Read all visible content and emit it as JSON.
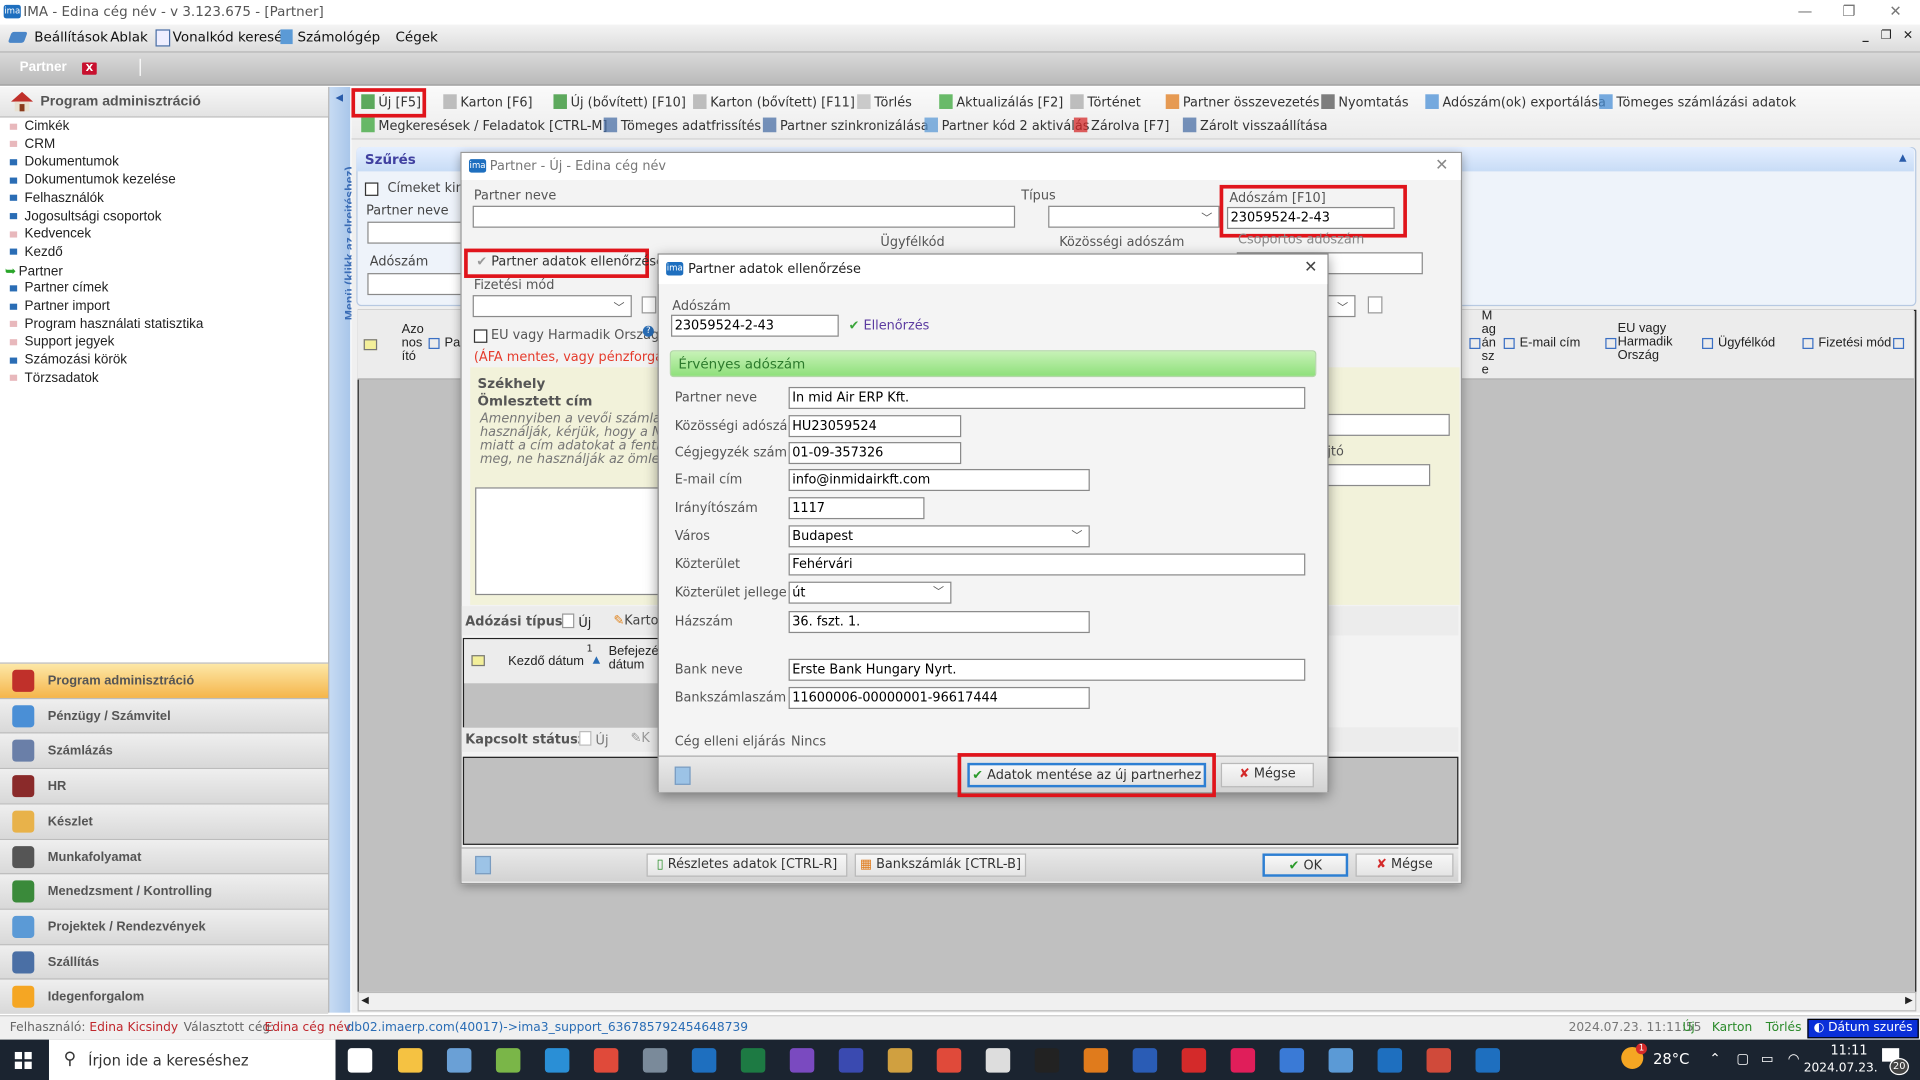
{
  "window": {
    "title": "IMA - Edina cég név - v 3.123.675 - [Partner]",
    "controls": [
      "minimize",
      "restore",
      "close"
    ]
  },
  "menubar": {
    "items": [
      {
        "label": "Beállítások",
        "icon": "settings-icon"
      },
      {
        "label": "Ablak",
        "icon": ""
      },
      {
        "label": "Vonalkód keresés",
        "icon": "barcode-search-icon"
      },
      {
        "label": "Számológép",
        "icon": "calculator-icon"
      },
      {
        "label": "Cégek",
        "icon": ""
      }
    ]
  },
  "tabs": {
    "active": "Partner",
    "close_label": "X"
  },
  "sidebar": {
    "header": "Program adminisztráció",
    "items": [
      {
        "label": "Cimkék",
        "bullet": "pink"
      },
      {
        "label": "CRM",
        "bullet": "pink"
      },
      {
        "label": "Dokumentumok",
        "bullet": "blue"
      },
      {
        "label": "Dokumentumok kezelése",
        "bullet": "blue"
      },
      {
        "label": "Felhasználók",
        "bullet": "blue"
      },
      {
        "label": "Jogosultsági csoportok",
        "bullet": "blue"
      },
      {
        "label": "Kedvencek",
        "bullet": "pink"
      },
      {
        "label": "Kezdő",
        "bullet": "blue"
      },
      {
        "label": "Partner",
        "bullet": "arrow",
        "active": true
      },
      {
        "label": "Partner címek",
        "bullet": "blue"
      },
      {
        "label": "Partner import",
        "bullet": "blue"
      },
      {
        "label": "Program használati statisztika",
        "bullet": "pink"
      },
      {
        "label": "Support jegyek",
        "bullet": "pink"
      },
      {
        "label": "Számozási körök",
        "bullet": "blue"
      },
      {
        "label": "Törzsadatok",
        "bullet": "pink"
      }
    ],
    "modules": [
      {
        "label": "Program adminisztráció",
        "icon": "house-icon",
        "active": true
      },
      {
        "label": "Pénzügy / Számvitel",
        "icon": "calculator-icon"
      },
      {
        "label": "Számlázás",
        "icon": "invoice-icon"
      },
      {
        "label": "HR",
        "icon": "people-icon"
      },
      {
        "label": "Készlet",
        "icon": "box-icon"
      },
      {
        "label": "Munkafolyamat",
        "icon": "tools-icon"
      },
      {
        "label": "Menedzsment / Kontrolling",
        "icon": "bar-chart-icon"
      },
      {
        "label": "Projektek / Rendezvények",
        "icon": "project-icon"
      },
      {
        "label": "Szállítás",
        "icon": "truck-icon"
      },
      {
        "label": "Idegenforgalom",
        "icon": "palm-icon"
      }
    ],
    "rail_label": "Menü (klikk az elrejtéshez)"
  },
  "toolbar": {
    "row1": [
      {
        "label": "Új [F5]",
        "highlighted": true
      },
      {
        "label": "Karton [F6]"
      },
      {
        "label": "Új (bővített) [F10]"
      },
      {
        "label": "Karton (bővített) [F11]"
      },
      {
        "label": "Törlés"
      },
      {
        "label": "Aktualizálás [F2]"
      },
      {
        "label": "Történet"
      },
      {
        "label": "Partner összevezetés"
      },
      {
        "label": "Nyomtatás"
      },
      {
        "label": "Adószám(ok) exportálása"
      },
      {
        "label": "Tömeges számlázási adatok"
      }
    ],
    "row2": [
      {
        "label": "Megkeresések / Feladatok [CTRL-M]"
      },
      {
        "label": "Tömeges adatfrissítés"
      },
      {
        "label": "Partner szinkronizálása"
      },
      {
        "label": "Partner kód 2 aktiválás"
      },
      {
        "label": "Zárolva [F7]"
      },
      {
        "label": "Zárolt visszaállítása"
      }
    ]
  },
  "filter": {
    "title": "Szűrés",
    "show_addresses": "Címeket kimutat",
    "partner_name_label": "Partner neve",
    "tax_number_label": "Adószám"
  },
  "grid": {
    "columns_left": [
      "Azo nos ító",
      "Par"
    ],
    "columns_right": [
      "M ag án sz e",
      "E-mail cím",
      "EU vagy Harmadik Ország",
      "Ügyfélkód",
      "Fizetési mód"
    ]
  },
  "partner_dialog": {
    "title": "Partner - Új  - Edina cég név",
    "partner_name_label": "Partner neve",
    "partner_name_value": "",
    "type_label": "Típus",
    "tax_label": "Adószám [F10]",
    "tax_value": "23059524-2-43",
    "client_code_label": "Ügyfélkód",
    "community_tax_label": "Közösségi adószám",
    "group_tax_label": "Csoportos adószám",
    "check_button": "Partner adatok ellenőrzése",
    "payment_label": "Fizetési mód",
    "eu_checkbox": "EU vagy Harmadik Ország",
    "vat_note": "(ÁFA mentes, vagy pénzforgalmis",
    "seat_title": "Székhely",
    "merged_address_title": "Ömlesztett cím",
    "merged_note": "Amennyiben a vevői számla kész használják, kérjük, hogy a NAV m miatt a cím adatokat a fenti mez meg, ne használják az ömleszte",
    "note_lines": [
      "Amennyiben a vevői számla kész",
      "használják, kérjük, hogy a NAV m",
      "miatt a cím adatokat a fenti mez",
      "meg, ne használják az ömleszte"
    ],
    "partial_label": "jtó",
    "tax_type_label": "Adózási típus",
    "tax_type_new": "Új",
    "tax_type_karton": "Karton",
    "tax_grid_cols": [
      "Kezdő dátum",
      "Befejezés dátum"
    ],
    "sort_index": "1",
    "linked_status_label": "Kapcsolt státusz",
    "linked_new": "Új",
    "linked_karton": "K",
    "details_button": "Részletes adatok [CTRL-R]",
    "bank_button": "Bankszámlák [CTRL-B]",
    "ok_button": "OK",
    "cancel_button": "Mégse"
  },
  "check_dialog": {
    "title": "Partner adatok ellenőrzése",
    "tax_label": "Adószám",
    "tax_value": "23059524-2-43",
    "check_link": "Ellenőrzés",
    "valid_message": "Érvényes adószám",
    "fields": [
      {
        "label": "Partner neve",
        "value": "In mid Air ERP Kft."
      },
      {
        "label": "Közösségi adószám",
        "value": "HU23059524"
      },
      {
        "label": "Cégjegyzék szám",
        "value": "01-09-357326"
      },
      {
        "label": "E-mail cím",
        "value": "info@inmidairkft.com"
      },
      {
        "label": "Irányítószám",
        "value": "1117"
      },
      {
        "label": "Város",
        "value": "Budapest"
      },
      {
        "label": "Közterület",
        "value": "Fehérvári"
      },
      {
        "label": "Közterület jellege",
        "value": "út"
      },
      {
        "label": "Házszám",
        "value": "36. fszt. 1."
      },
      {
        "label": "Bank neve",
        "value": "Erste Bank Hungary Nyrt."
      },
      {
        "label": "Bankszámlaszám",
        "value": "11600006-00000001-96617444"
      },
      {
        "label": "Cég elleni eljárás",
        "value": "Nincs"
      }
    ],
    "save_button": "Adatok mentése az új partnerhez",
    "cancel_button": "Mégse"
  },
  "statusbar": {
    "user_label": "Felhasználó:",
    "user_value": "Edina Kicsindy",
    "company_label": "Választott cég:",
    "company_value": "Edina cég név",
    "db": "db02.imaerp.com(40017)->ima3_support_636785792454648739",
    "timestamp": "2024.07.23. 11:11:55",
    "actions": [
      "Új",
      "Karton",
      "Törlés"
    ],
    "date_filter": "Dátum szurés"
  },
  "taskbar": {
    "search_placeholder": "Írjon ide a kereséshez",
    "weather": "28°C",
    "weather_badge": "1",
    "time": "11:11",
    "date": "2024.07.23.",
    "notifications": "20"
  },
  "colors": {
    "highlight_red": "#e0141b",
    "accent_blue": "#2d7fd3",
    "valid_green": "#8fe07b",
    "active_module": "#f5b54a",
    "status_red": "#c0272d"
  }
}
